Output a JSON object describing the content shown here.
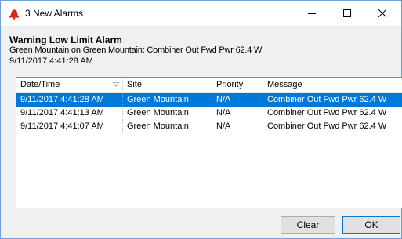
{
  "window": {
    "title": "3 New Alarms",
    "controls": {
      "minimize": "minimize",
      "maximize": "maximize",
      "close": "close"
    }
  },
  "alarm": {
    "title": "Warning Low Limit Alarm",
    "description": "Green Mountain on Green Mountain: Combiner Out Fwd Pwr 62.4 W",
    "time": "9/11/2017 4:41:28 AM"
  },
  "table": {
    "columns": [
      "Date/Time",
      "Site",
      "Priority",
      "Message"
    ],
    "sorted_column": "Date/Time",
    "rows": [
      {
        "datetime": "9/11/2017 4:41:28 AM",
        "site": "Green Mountain",
        "priority": "N/A",
        "message": "Combiner Out Fwd Pwr 62.4 W",
        "selected": true
      },
      {
        "datetime": "9/11/2017 4:41:13 AM",
        "site": "Green Mountain",
        "priority": "N/A",
        "message": "Combiner Out Fwd Pwr 62.4 W",
        "selected": false
      },
      {
        "datetime": "9/11/2017 4:41:07 AM",
        "site": "Green Mountain",
        "priority": "N/A",
        "message": "Combiner Out Fwd Pwr 62.4 W",
        "selected": false
      }
    ]
  },
  "buttons": {
    "clear": "Clear",
    "ok": "OK"
  },
  "colors": {
    "selection": "#0078d7",
    "alarm_icon": "#d9271e"
  },
  "icons": {
    "title": "alarm-bell-icon",
    "sort": "sort-descending-icon"
  }
}
